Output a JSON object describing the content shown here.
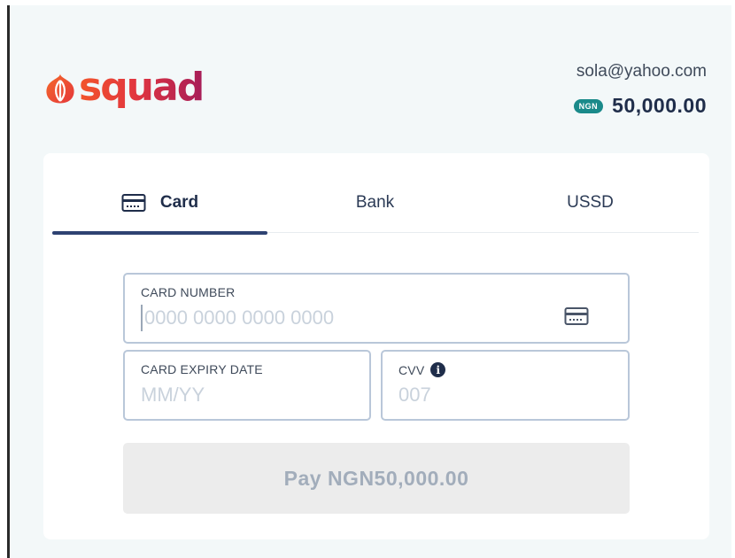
{
  "brand": {
    "name": "squad"
  },
  "header": {
    "email": "sola@yahoo.com",
    "currency_badge": "NGN",
    "amount": "50,000.00"
  },
  "tabs": [
    {
      "label": "Card",
      "active": true
    },
    {
      "label": "Bank",
      "active": false
    },
    {
      "label": "USSD",
      "active": false
    }
  ],
  "form": {
    "card_number": {
      "label": "CARD NUMBER",
      "placeholder": "0000 0000 0000 0000",
      "value": ""
    },
    "expiry": {
      "label": "CARD EXPIRY DATE",
      "placeholder": "MM/YY",
      "value": ""
    },
    "cvv": {
      "label": "CVV",
      "placeholder": "007",
      "value": ""
    },
    "pay_button": "Pay NGN50,000.00"
  },
  "icons": {
    "logo": "onion-logo-icon",
    "card_tab": "credit-card-icon",
    "card_field": "credit-card-icon",
    "cvv_info": "info-icon"
  },
  "colors": {
    "brand_orange": "#f2552b",
    "brand_magenta": "#a71d58",
    "badge_teal": "#1a8a8a",
    "navy": "#1f2d4a",
    "tab_underline": "#2e4272",
    "button_disabled_bg": "#ececec"
  }
}
